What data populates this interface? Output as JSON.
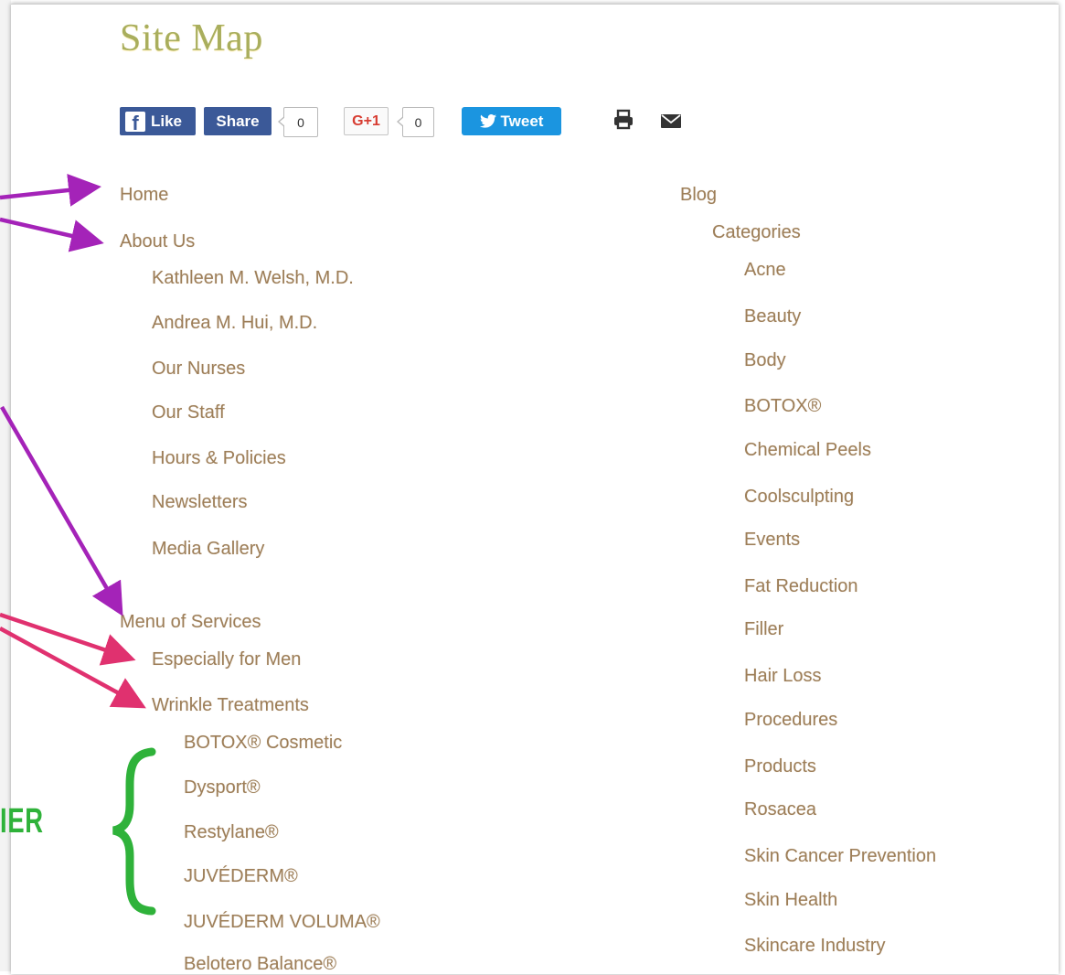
{
  "page": {
    "title": "Site Map"
  },
  "social": {
    "like_label": "Like",
    "like_icon": "f",
    "share_label": "Share",
    "share_count": "0",
    "gplus_label": "G+1",
    "gplus_count": "0",
    "tweet_label": "Tweet",
    "print_icon": "print-icon",
    "email_icon": "email-icon"
  },
  "left_menu": {
    "home": "Home",
    "about": {
      "label": "About Us",
      "children": [
        "Kathleen M. Welsh, M.D.",
        "Andrea M. Hui, M.D.",
        "Our Nurses",
        "Our Staff",
        "Hours & Policies",
        "Newsletters",
        "Media Gallery"
      ]
    },
    "services": {
      "label": "Menu of Services",
      "children": [
        "Especially for Men",
        "Wrinkle Treatments"
      ],
      "wrinkle_children": [
        "BOTOX® Cosmetic",
        "Dysport®",
        "Restylane®",
        "JUVÉDERM®",
        "JUVÉDERM VOLUMA®",
        "Belotero Balance®"
      ]
    }
  },
  "right_menu": {
    "blog": "Blog",
    "categories": {
      "label": "Categories",
      "items": [
        "Acne",
        "Beauty",
        "Body",
        "BOTOX®",
        "Chemical Peels",
        "Coolsculpting",
        "Events",
        "Fat Reduction",
        "Filler",
        "Hair Loss",
        "Procedures",
        "Products",
        "Rosacea",
        "Skin Cancer Prevention",
        "Skin Health",
        "Skincare Industry"
      ]
    }
  },
  "annotations": {
    "tier_label": "IER",
    "arrow_colors": {
      "purple": "#a423b8",
      "pink": "#e0316f",
      "green": "#2fb23a"
    }
  },
  "colors": {
    "link": "#9d7e58",
    "title": "#a9ae5d",
    "facebook": "#3b5998",
    "twitter": "#1b95e0",
    "gplus": "#d73d32"
  }
}
